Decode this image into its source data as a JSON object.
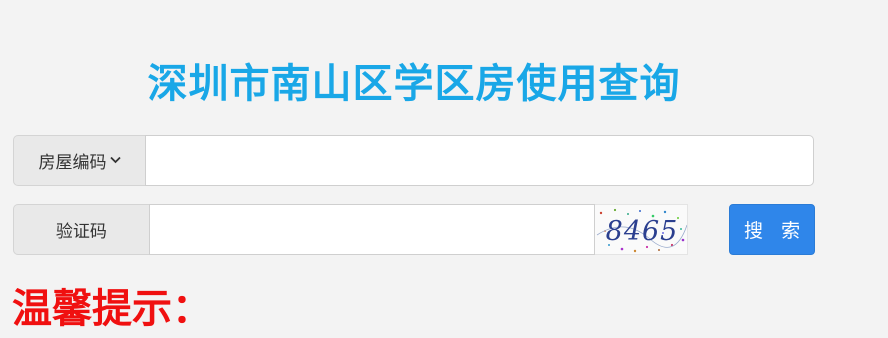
{
  "header": {
    "title": "深圳市南山区学区房使用查询"
  },
  "search_form": {
    "query_type": {
      "selected_label": "房屋编码",
      "icon": "chevron-down-icon"
    },
    "query_input": {
      "value": "",
      "placeholder": ""
    },
    "captcha": {
      "label": "验证码",
      "input_value": "",
      "input_placeholder": "",
      "image_text": "8465"
    },
    "search_button_label": "搜 索"
  },
  "tips": {
    "title": "温馨提示："
  },
  "colors": {
    "title": "#19a7e7",
    "primary_button": "#2f86ea",
    "tips_title": "#f01010",
    "background": "#f3f3f3"
  }
}
